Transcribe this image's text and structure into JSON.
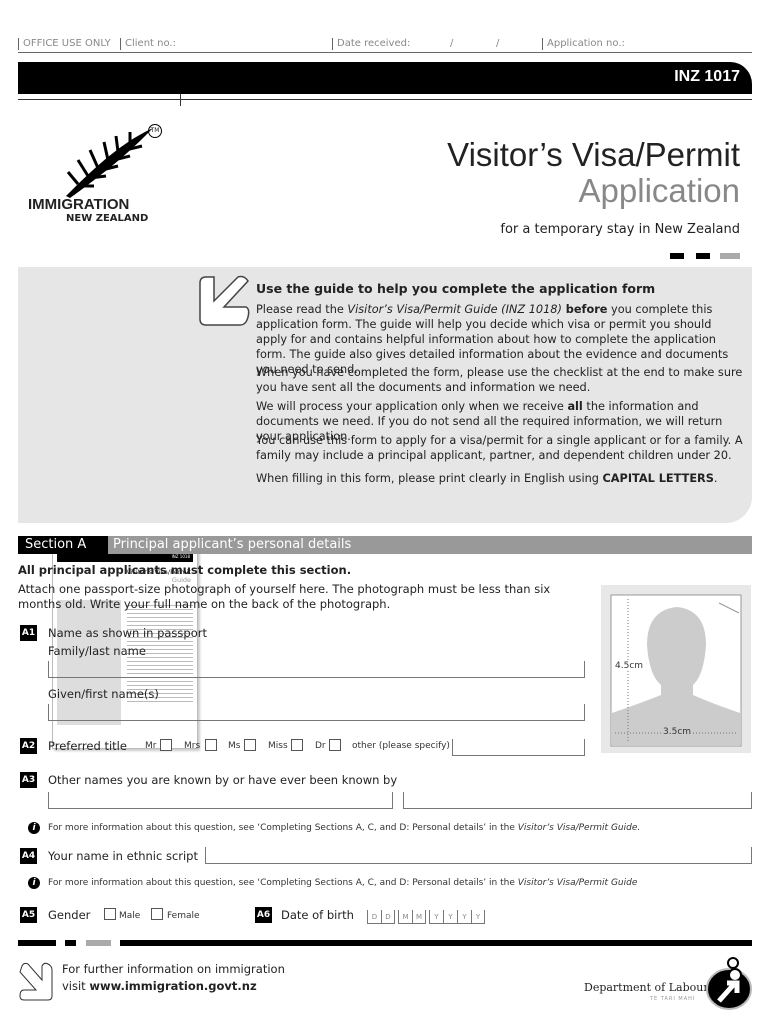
{
  "office_use": {
    "label": "OFFICE USE ONLY",
    "client_no": "Client no.:",
    "date_received": "Date received:",
    "slash": "/",
    "application_no": "Application no.:"
  },
  "form_code": "INZ 1017",
  "logo": {
    "line1": "IMMIGRATION",
    "line2": "NEW ZEALAND",
    "tm": "TM"
  },
  "title": {
    "line1": "Visitor’s Visa/Permit",
    "line2": "Application",
    "subtitle": "for a temporary stay in New Zealand"
  },
  "guide": {
    "heading": "Use the guide to help you complete the application form",
    "p1_pre": "Please read the ",
    "p1_italic": "Visitor’s Visa/Permit Guide (INZ 1018)",
    "p1_bold": " before",
    "p1_post": " you complete this application form. The guide will help you decide which visa or permit you should apply for and contains helpful information about how to complete the application form. The guide also gives detailed information about the evidence and documents you need to send.",
    "p2": "When you have completed the form, please use the checklist at the end to make sure you have sent all the documents and information we need.",
    "p3_pre": "We will process your application only when we receive ",
    "p3_bold": "all",
    "p3_post": " the information and documents we need. If you do not send all the required information, we will return your application.",
    "p4": "You can use this form to apply for a visa/permit for a single applicant or for a family. A family may include a principal applicant, partner, and dependent children under 20.",
    "p5_pre": "When filling in this form, please print clearly in English using ",
    "p5_bold": "CAPITAL LETTERS",
    "p5_post": ".",
    "thumb": {
      "code": "INZ 1018",
      "title": "Visitor’s Visa/Permit",
      "subtitle": "Guide"
    }
  },
  "section": {
    "label": "Section A",
    "title": "Principal applicant’s personal details",
    "must": "All principal applicants must complete this section.",
    "photo_text": "Attach one passport-size photograph of yourself here. The photograph must be less than six months old. Write your full name on the back of the photograph."
  },
  "photo": {
    "height": "4.5cm",
    "width": "3.5cm"
  },
  "a1": {
    "num": "A1",
    "label": "Name as shown in passport",
    "family": "Family/last name",
    "given": "Given/first name(s)"
  },
  "a2": {
    "num": "A2",
    "label": "Preferred title",
    "options": [
      "Mr",
      "Mrs",
      "Ms",
      "Miss",
      "Dr"
    ],
    "other": "other (please specify)"
  },
  "a3": {
    "num": "A3",
    "label": "Other names you are known by or have ever been known by"
  },
  "info1": {
    "pre": "For more information about this question, see ‘Completing Sections A, C, and D: Personal details’ in the ",
    "italic": "Visitor’s Visa/Permit Guide."
  },
  "a4": {
    "num": "A4",
    "label": "Your name in ethnic script"
  },
  "info2": {
    "pre": "For more information about this question, see ‘Completing Sections A, C, and D: Personal details’ in the ",
    "italic": "Visitor’s Visa/Permit Guide"
  },
  "a5": {
    "num": "A5",
    "label": "Gender",
    "options": [
      "Male",
      "Female"
    ]
  },
  "a6": {
    "num": "A6",
    "label": "Date of birth",
    "placeholders": [
      "D",
      "D",
      "M",
      "M",
      "Y",
      "Y",
      "Y",
      "Y"
    ]
  },
  "footer": {
    "line1": "For further information on immigration",
    "visit": "visit ",
    "url": "www.immigration.govt.nz",
    "dept": "Department of Labour",
    "dept_sub": "TE TARI MAHI"
  }
}
